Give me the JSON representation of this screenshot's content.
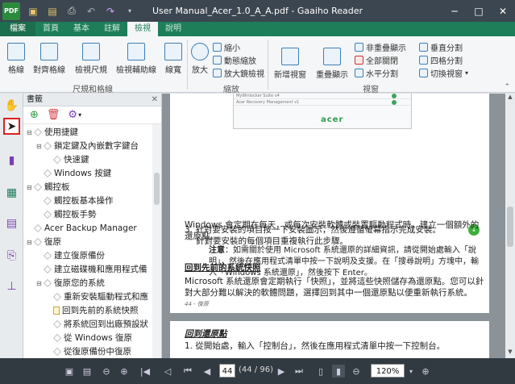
{
  "app": {
    "logo": "PDF",
    "title": "User Manual_Acer_1.0_A_A.pdf - Gaaiho Reader"
  },
  "quick_access": [
    "folder-icon",
    "save-icon",
    "print-icon",
    "undo-icon",
    "redo-icon",
    "customize-icon"
  ],
  "window_buttons": {
    "minimize": "─",
    "maximize": "□",
    "close": "✕"
  },
  "tabs": [
    {
      "label": "檔案"
    },
    {
      "label": "首頁"
    },
    {
      "label": "基本"
    },
    {
      "label": "註解"
    },
    {
      "label": "檢視"
    },
    {
      "label": "說明"
    }
  ],
  "ribbon": {
    "large_buttons": [
      {
        "label": "格線"
      },
      {
        "label": "對齊格線"
      },
      {
        "label": "檢視尺規"
      },
      {
        "label": "檢視輔助線"
      },
      {
        "label": "線寬"
      },
      {
        "label": "放大"
      },
      {
        "label": "新增視窗"
      },
      {
        "label": "重疊顯示"
      }
    ],
    "zoom_small": [
      "縮小",
      "動態縮放",
      "放大鏡檢視"
    ],
    "window_small": [
      "非重疊顯示",
      "全部關閉",
      "水平分割"
    ],
    "split_small": [
      "垂直分割",
      "四格分割",
      "切換視窗"
    ],
    "groups": {
      "ruler_grid": "尺規和格線",
      "zoom": "縮放",
      "window": "視窗"
    }
  },
  "bookmark_panel": {
    "title": "書籤",
    "items": [
      {
        "label": "使用捷鍵",
        "level": 1,
        "expanded": true
      },
      {
        "label": "鎖定鍵及內嵌數字鍵台",
        "level": 2,
        "expanded": true
      },
      {
        "label": "快速鍵",
        "level": 3
      },
      {
        "label": "Windows 按鍵",
        "level": 2
      },
      {
        "label": "觸控板",
        "level": 1,
        "expanded": true
      },
      {
        "label": "觸控板基本操作",
        "level": 2
      },
      {
        "label": "觸控板手勢",
        "level": 2
      },
      {
        "label": "Acer Backup Manager",
        "level": 1
      },
      {
        "label": "復原",
        "level": 1,
        "expanded": true
      },
      {
        "label": "建立復原備份",
        "level": 2
      },
      {
        "label": "建立磁碟機和應用程式備",
        "level": 2
      },
      {
        "label": "復原您的系統",
        "level": 2,
        "expanded": true
      },
      {
        "label": "重新安裝驅動程式和應",
        "level": 3
      },
      {
        "label": "回到先前的系統快照",
        "level": 3,
        "doc": true
      },
      {
        "label": "將系統回到出廠預設狀",
        "level": 3
      },
      {
        "label": "從 Windows 復原",
        "level": 3
      },
      {
        "label": "從復原備份中復原",
        "level": 3
      },
      {
        "label": "電源管理",
        "level": 1
      }
    ]
  },
  "document": {
    "step3": "3. 針對要安裝的項目按一下安裝圖示，然後遵循螢幕指示完成安裝。",
    "step3b": "針對要安裝的每個項目重複執行此步驟。",
    "heading1": "回到先前的系統快照",
    "para1": "Microsoft 系統還原會定期執行「快照」，並將這些快照儲存為還原點。您可以針對大部分難以解決的軟體問題，選擇回到其中一個還原點以便重新執行系統。",
    "para2": "Windows 會定期在每天，或每次安裝軟體或裝置驅動程式時，建立一個額外的還原點。",
    "note_label": "注意",
    "note_text": "：如需關於使用 Microsoft 系統還原的詳細資訊，請從開始處輸入「說明」，然後在應用程式清單中按一下說明及支援。在「搜尋說明」方塊中，輸入「Windows 系統還原」，然後按下 Enter。",
    "page_footer": "44 - 復原",
    "heading2": "回到還原點",
    "page2_step1": "1. 從開始處，輸入「控制台」，然後在應用程式清單中按一下控制台。",
    "screenshot_rows": [
      "MyWinlocker Suite v4",
      "Acer Recovery Management v1"
    ],
    "screenshot_logo": "acer"
  },
  "statusbar": {
    "current_page": "44",
    "page_count": "(44 / 96)",
    "zoom": "120%"
  }
}
